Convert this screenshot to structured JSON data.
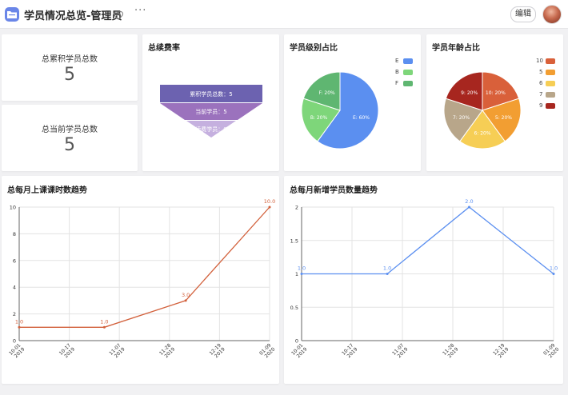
{
  "header": {
    "title": "学员情况总览-管理员",
    "more_label": "···",
    "edit_label": "编辑"
  },
  "stats": [
    {
      "label": "总累积学员总数",
      "value": "5"
    },
    {
      "label": "总当前学员总数",
      "value": "5"
    }
  ],
  "funnel": {
    "title": "总续费率",
    "stages": [
      {
        "label": "累积学员总数：5",
        "color": "#6c62b0"
      },
      {
        "label": "当前学员：5",
        "color": "#8f6fba"
      },
      {
        "label": "续费学员：0",
        "color": "#bca7d8"
      }
    ]
  },
  "level_pie": {
    "title": "学员级别占比",
    "slices": [
      {
        "name": "E",
        "value": 60,
        "label": "E: 60%",
        "color": "#5b8ff0"
      },
      {
        "name": "B",
        "value": 20,
        "label": "B: 20%",
        "color": "#7ed67a"
      },
      {
        "name": "F",
        "value": 20,
        "label": "F: 20%",
        "color": "#5fb671"
      }
    ]
  },
  "age_pie": {
    "title": "学员年龄占比",
    "slices": [
      {
        "name": "10",
        "value": 20,
        "label": "10: 20%",
        "color": "#d9603a"
      },
      {
        "name": "5",
        "value": 20,
        "label": "5: 20%",
        "color": "#f29e32"
      },
      {
        "name": "6",
        "value": 20,
        "label": "6: 20%",
        "color": "#f6ce55"
      },
      {
        "name": "7",
        "value": 20,
        "label": "7: 20%",
        "color": "#b8a68a"
      },
      {
        "name": "9",
        "value": 20,
        "label": "9: 20%",
        "color": "#a7261f"
      }
    ]
  },
  "chart_data": [
    {
      "type": "line",
      "title": "总每月上课课时数趋势",
      "color": "#d2603b",
      "x": [
        "10-01\n2019",
        "10-17\n2019",
        "11-07\n2019",
        "11-28\n2019",
        "12-19\n2019",
        "01-09\n2020"
      ],
      "points": [
        {
          "x_frac": 0.0,
          "y": 1.0,
          "label": "1.0"
        },
        {
          "x_frac": 0.34,
          "y": 1.0,
          "label": "1.0"
        },
        {
          "x_frac": 0.665,
          "y": 3.0,
          "label": "3.0"
        },
        {
          "x_frac": 1.0,
          "y": 10.0,
          "label": "10.0"
        }
      ],
      "yticks": [
        "0",
        "2",
        "4",
        "6",
        "8",
        "10"
      ],
      "ylim": [
        0,
        10
      ]
    },
    {
      "type": "line",
      "title": "总每月新增学员数量趋势",
      "color": "#5b8ff0",
      "x": [
        "10-01\n2019",
        "10-17\n2019",
        "11-07\n2019",
        "11-28\n2019",
        "12-19\n2019",
        "01-09\n2020"
      ],
      "points": [
        {
          "x_frac": 0.0,
          "y": 1.0,
          "label": "1.0"
        },
        {
          "x_frac": 0.34,
          "y": 1.0,
          "label": "1.0"
        },
        {
          "x_frac": 0.665,
          "y": 2.0,
          "label": "2.0"
        },
        {
          "x_frac": 1.0,
          "y": 1.0,
          "label": "1.0"
        }
      ],
      "yticks": [
        "0",
        "0.5",
        "1",
        "1.5",
        "2"
      ],
      "ylim": [
        0,
        2
      ]
    }
  ]
}
